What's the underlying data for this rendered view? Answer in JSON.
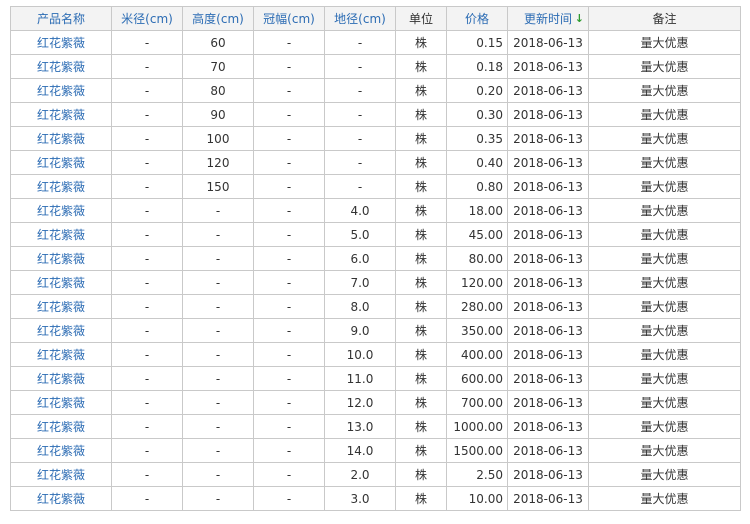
{
  "columns": {
    "name": "产品名称",
    "rice_diameter": "米径(cm)",
    "height": "高度(cm)",
    "crown": "冠幅(cm)",
    "ground_diameter": "地径(cm)",
    "unit": "单位",
    "price": "价格",
    "updated": "更新时间",
    "note": "备注"
  },
  "sort_arrow": "↓",
  "accent_color": "#2c6cb4",
  "rows": [
    {
      "name": "红花紫薇",
      "rice": "-",
      "height": "60",
      "crown": "-",
      "ground": "-",
      "unit": "株",
      "price": "0.15",
      "date": "2018-06-13",
      "note": "量大优惠"
    },
    {
      "name": "红花紫薇",
      "rice": "-",
      "height": "70",
      "crown": "-",
      "ground": "-",
      "unit": "株",
      "price": "0.18",
      "date": "2018-06-13",
      "note": "量大优惠"
    },
    {
      "name": "红花紫薇",
      "rice": "-",
      "height": "80",
      "crown": "-",
      "ground": "-",
      "unit": "株",
      "price": "0.20",
      "date": "2018-06-13",
      "note": "量大优惠"
    },
    {
      "name": "红花紫薇",
      "rice": "-",
      "height": "90",
      "crown": "-",
      "ground": "-",
      "unit": "株",
      "price": "0.30",
      "date": "2018-06-13",
      "note": "量大优惠"
    },
    {
      "name": "红花紫薇",
      "rice": "-",
      "height": "100",
      "crown": "-",
      "ground": "-",
      "unit": "株",
      "price": "0.35",
      "date": "2018-06-13",
      "note": "量大优惠"
    },
    {
      "name": "红花紫薇",
      "rice": "-",
      "height": "120",
      "crown": "-",
      "ground": "-",
      "unit": "株",
      "price": "0.40",
      "date": "2018-06-13",
      "note": "量大优惠"
    },
    {
      "name": "红花紫薇",
      "rice": "-",
      "height": "150",
      "crown": "-",
      "ground": "-",
      "unit": "株",
      "price": "0.80",
      "date": "2018-06-13",
      "note": "量大优惠"
    },
    {
      "name": "红花紫薇",
      "rice": "-",
      "height": "-",
      "crown": "-",
      "ground": "4.0",
      "unit": "株",
      "price": "18.00",
      "date": "2018-06-13",
      "note": "量大优惠"
    },
    {
      "name": "红花紫薇",
      "rice": "-",
      "height": "-",
      "crown": "-",
      "ground": "5.0",
      "unit": "株",
      "price": "45.00",
      "date": "2018-06-13",
      "note": "量大优惠"
    },
    {
      "name": "红花紫薇",
      "rice": "-",
      "height": "-",
      "crown": "-",
      "ground": "6.0",
      "unit": "株",
      "price": "80.00",
      "date": "2018-06-13",
      "note": "量大优惠"
    },
    {
      "name": "红花紫薇",
      "rice": "-",
      "height": "-",
      "crown": "-",
      "ground": "7.0",
      "unit": "株",
      "price": "120.00",
      "date": "2018-06-13",
      "note": "量大优惠"
    },
    {
      "name": "红花紫薇",
      "rice": "-",
      "height": "-",
      "crown": "-",
      "ground": "8.0",
      "unit": "株",
      "price": "280.00",
      "date": "2018-06-13",
      "note": "量大优惠"
    },
    {
      "name": "红花紫薇",
      "rice": "-",
      "height": "-",
      "crown": "-",
      "ground": "9.0",
      "unit": "株",
      "price": "350.00",
      "date": "2018-06-13",
      "note": "量大优惠"
    },
    {
      "name": "红花紫薇",
      "rice": "-",
      "height": "-",
      "crown": "-",
      "ground": "10.0",
      "unit": "株",
      "price": "400.00",
      "date": "2018-06-13",
      "note": "量大优惠"
    },
    {
      "name": "红花紫薇",
      "rice": "-",
      "height": "-",
      "crown": "-",
      "ground": "11.0",
      "unit": "株",
      "price": "600.00",
      "date": "2018-06-13",
      "note": "量大优惠"
    },
    {
      "name": "红花紫薇",
      "rice": "-",
      "height": "-",
      "crown": "-",
      "ground": "12.0",
      "unit": "株",
      "price": "700.00",
      "date": "2018-06-13",
      "note": "量大优惠"
    },
    {
      "name": "红花紫薇",
      "rice": "-",
      "height": "-",
      "crown": "-",
      "ground": "13.0",
      "unit": "株",
      "price": "1000.00",
      "date": "2018-06-13",
      "note": "量大优惠"
    },
    {
      "name": "红花紫薇",
      "rice": "-",
      "height": "-",
      "crown": "-",
      "ground": "14.0",
      "unit": "株",
      "price": "1500.00",
      "date": "2018-06-13",
      "note": "量大优惠"
    },
    {
      "name": "红花紫薇",
      "rice": "-",
      "height": "-",
      "crown": "-",
      "ground": "2.0",
      "unit": "株",
      "price": "2.50",
      "date": "2018-06-13",
      "note": "量大优惠"
    },
    {
      "name": "红花紫薇",
      "rice": "-",
      "height": "-",
      "crown": "-",
      "ground": "3.0",
      "unit": "株",
      "price": "10.00",
      "date": "2018-06-13",
      "note": "量大优惠"
    }
  ]
}
